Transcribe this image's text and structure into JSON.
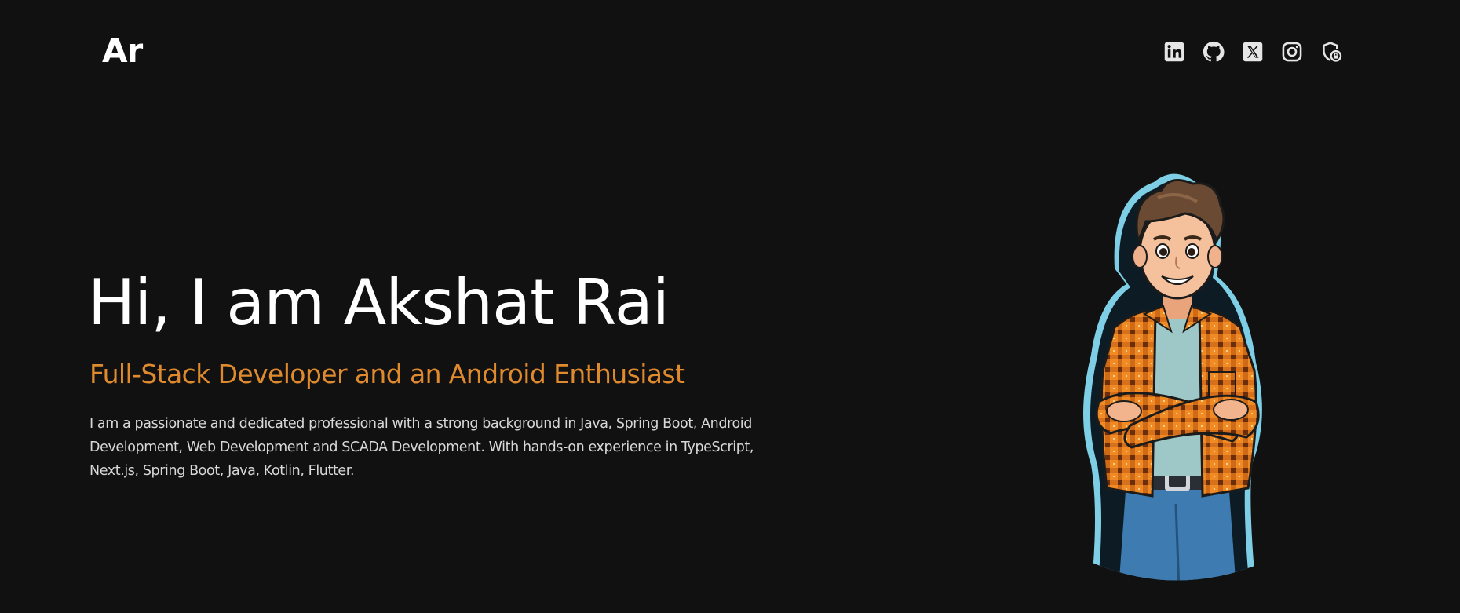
{
  "header": {
    "logo_text": "Ar",
    "social_links": [
      {
        "name": "linkedin-icon",
        "label": "LinkedIn"
      },
      {
        "name": "github-icon",
        "label": "GitHub"
      },
      {
        "name": "x-icon",
        "label": "X"
      },
      {
        "name": "instagram-icon",
        "label": "Instagram"
      },
      {
        "name": "privacy-shield-icon",
        "label": "Privacy"
      }
    ],
    "icon_color": "#e6e6e6"
  },
  "hero": {
    "title": "Hi, I am Akshat Rai",
    "subtitle": "Full-Stack Developer and an Android Enthusiast",
    "description": "I am a passionate and dedicated professional with a strong background in Java, Spring Boot, Android Development, Web Development and SCADA Development. With hands-on experience in TypeScript, Next.js, Spring Boot, Java, Kotlin, Flutter."
  },
  "colors": {
    "background": "#111111",
    "accent": "#e08a2e",
    "text": "#ffffff"
  }
}
